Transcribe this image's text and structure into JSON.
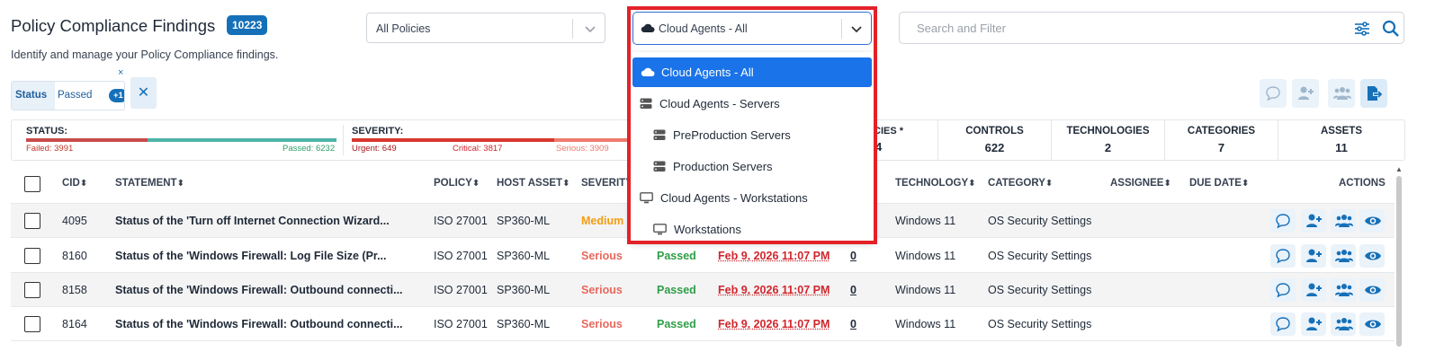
{
  "header": {
    "title": "Policy Compliance Findings",
    "count": "10223",
    "subtitle": "Identify and manage your Policy Compliance findings."
  },
  "policies_select": {
    "value": "All Policies"
  },
  "agents_select": {
    "value": "Cloud Agents - All"
  },
  "search": {
    "placeholder": "Search and Filter"
  },
  "filter_chip": {
    "key": "Status",
    "value": "Passed",
    "extra": "+1",
    "remove": "×",
    "clear_all": "✕"
  },
  "summary": {
    "status_label": "STATUS:",
    "failed": "Failed: 3991",
    "passed": "Passed: 6232",
    "status_failed_fraction": 0.39,
    "severity_label": "SEVERITY:",
    "urgent": "Urgent: 649",
    "critical": "Critical: 3817",
    "serious": "Serious: 3909",
    "policies_label": "ICIES *",
    "policies_value": "4",
    "controls_label": "CONTROLS",
    "controls_value": "622",
    "technologies_label": "TECHNOLOGIES",
    "technologies_value": "2",
    "categories_label": "CATEGORIES",
    "categories_value": "7",
    "assets_label": "ASSETS",
    "assets_value": "11"
  },
  "columns": {
    "cid": "CID",
    "statement": "STATEMENT",
    "policy": "POLICY",
    "host_asset": "HOST ASSET",
    "severity": "SEVERITY",
    "technology": "TECHNOLOGY",
    "category": "CATEGORY",
    "assignee": "ASSIGNEE",
    "due_date": "DUE DATE",
    "actions": "ACTIONS",
    "sort_glyph": "⬍"
  },
  "rows": [
    {
      "cid": "4095",
      "statement": "Status of the 'Turn off Internet Connection Wizard...",
      "policy": "ISO 27001",
      "host": "SP360-ML",
      "severity": "Medium",
      "status": "",
      "due": "",
      "assets": "",
      "technology": "Windows 11",
      "category": "OS Security Settings"
    },
    {
      "cid": "8160",
      "statement": "Status of the 'Windows Firewall: Log File Size (Pr...",
      "policy": "ISO 27001",
      "host": "SP360-ML",
      "severity": "Serious",
      "status": "Passed",
      "due": "Feb 9, 2026 11:07 PM",
      "assets": "0",
      "technology": "Windows 11",
      "category": "OS Security Settings"
    },
    {
      "cid": "8158",
      "statement": "Status of the 'Windows Firewall: Outbound connecti...",
      "policy": "ISO 27001",
      "host": "SP360-ML",
      "severity": "Serious",
      "status": "Passed",
      "due": "Feb 9, 2026 11:07 PM",
      "assets": "0",
      "technology": "Windows 11",
      "category": "OS Security Settings"
    },
    {
      "cid": "8164",
      "statement": "Status of the 'Windows Firewall: Outbound connecti...",
      "policy": "ISO 27001",
      "host": "SP360-ML",
      "severity": "Serious",
      "status": "Passed",
      "due": "Feb 9, 2026 11:07 PM",
      "assets": "0",
      "technology": "Windows 11",
      "category": "OS Security Settings"
    }
  ],
  "dropdown": {
    "items": [
      {
        "label": "Cloud Agents - All",
        "icon": "cloud-icon",
        "selected": true
      },
      {
        "label": "Cloud Agents - Servers",
        "icon": "server-icon"
      },
      {
        "label": "PreProduction Servers",
        "icon": "server-icon"
      },
      {
        "label": "Production Servers",
        "icon": "server-icon"
      },
      {
        "label": "Cloud Agents - Workstations",
        "icon": "monitor-icon"
      },
      {
        "label": "Workstations",
        "icon": "monitor-icon"
      }
    ]
  },
  "colors": {
    "accent": "#1570b8",
    "selected": "#1a73e8",
    "highlight_frame": "#e32128",
    "failed": "#c0392b",
    "passed": "#2e9e47",
    "medium": "#f39c12",
    "serious": "#e8685c"
  }
}
